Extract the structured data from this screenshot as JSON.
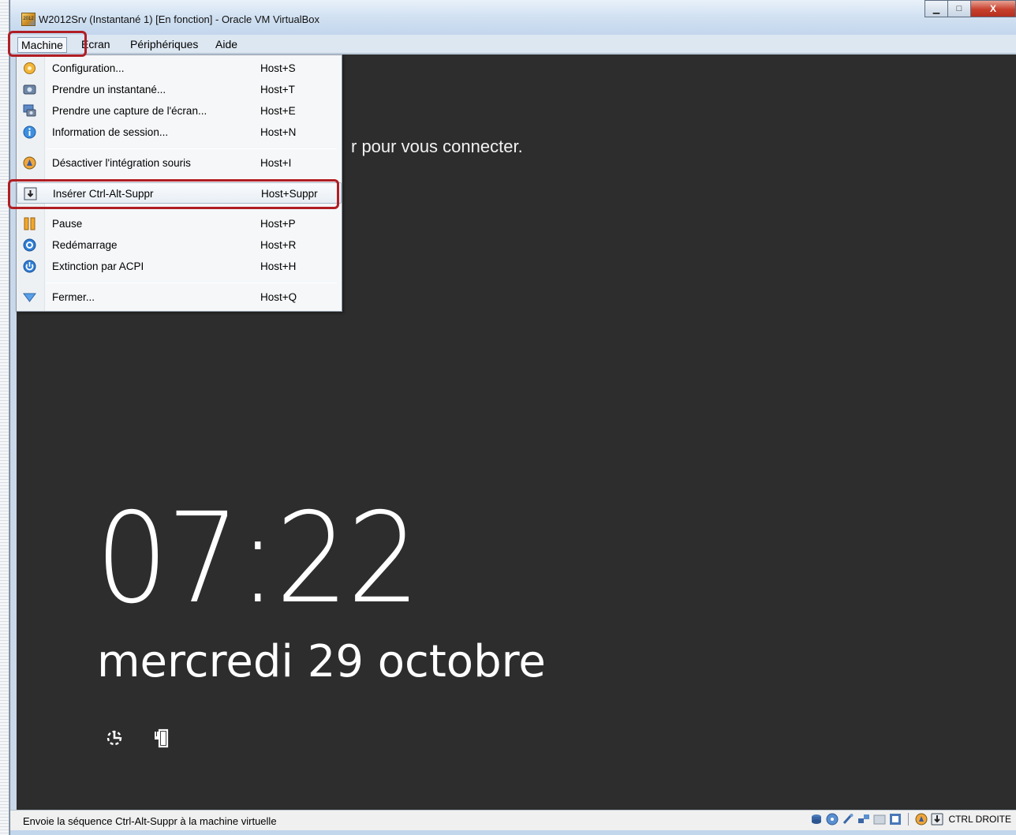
{
  "window": {
    "title": "W2012Srv (Instantané 1) [En fonction] - Oracle VM VirtualBox",
    "icon_label": "2012",
    "minimize": "▁",
    "maximize": "□",
    "close": "X"
  },
  "menubar": {
    "machine": "Machine",
    "ecran": "Écran",
    "peripheriques": "Périphériques",
    "aide": "Aide"
  },
  "dropdown": {
    "items": [
      {
        "label": "Configuration...",
        "shortcut": "Host+S",
        "icon": "gear-icon"
      },
      {
        "label": "Prendre un instantané...",
        "shortcut": "Host+T",
        "icon": "camera-icon"
      },
      {
        "label": "Prendre une capture de l'écran...",
        "shortcut": "Host+E",
        "icon": "screenshot-icon"
      },
      {
        "label": "Information de session...",
        "shortcut": "Host+N",
        "icon": "info-icon"
      },
      {
        "label": "Désactiver l'intégration souris",
        "shortcut": "Host+I",
        "icon": "mouse-integration-icon"
      },
      {
        "label": "Insérer Ctrl-Alt-Suppr",
        "shortcut": "Host+Suppr",
        "icon": "keyboard-insert-icon"
      },
      {
        "label": "Pause",
        "shortcut": "Host+P",
        "icon": "pause-icon"
      },
      {
        "label": "Redémarrage",
        "shortcut": "Host+R",
        "icon": "reset-icon"
      },
      {
        "label": "Extinction par ACPI",
        "shortcut": "Host+H",
        "icon": "power-icon"
      },
      {
        "label": "Fermer...",
        "shortcut": "Host+Q",
        "icon": "close-down-icon"
      }
    ]
  },
  "vm_screen": {
    "connect_text": "r pour vous connecter.",
    "time": "07:22",
    "date": "mercredi 29 octobre",
    "icons": [
      "ease-of-access-icon",
      "battery-icon"
    ]
  },
  "statusbar": {
    "text": "Envoie la séquence Ctrl-Alt-Suppr à la machine virtuelle",
    "host_key": "CTRL DROITE"
  },
  "colors": {
    "highlight_box": "#b01e24",
    "vm_background": "#2d2d2d"
  }
}
